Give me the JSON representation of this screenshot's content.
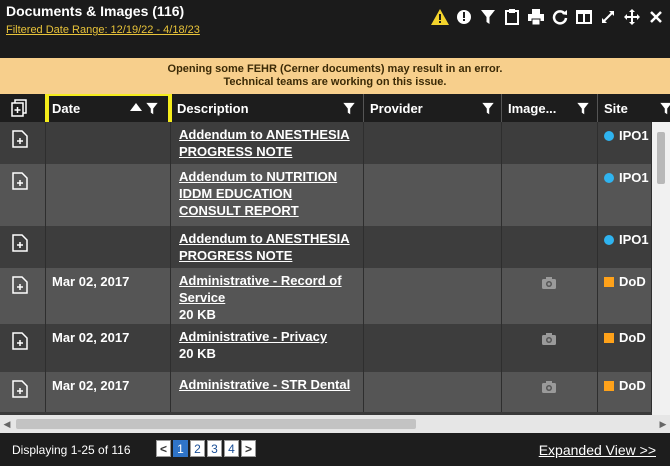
{
  "header": {
    "title": "Documents & Images (116)",
    "date_range": "Filtered Date Range: 12/19/22 - 4/18/23"
  },
  "toolbar": {
    "icons": [
      "warning-icon",
      "info-icon",
      "filter-icon",
      "clipboard-icon",
      "print-icon",
      "refresh-icon",
      "columns-icon",
      "expand-icon",
      "move-icon",
      "close-icon"
    ]
  },
  "banner": {
    "line1": "Opening some FEHR (Cerner documents) may result in an error.",
    "line2": "Technical teams are working on this issue."
  },
  "columns": {
    "date": "Date",
    "description": "Description",
    "provider": "Provider",
    "image": "Image...",
    "site": "Site"
  },
  "rows": [
    {
      "date": "",
      "desc_lines": [
        "Addendum to ANESTHESIA",
        "PROGRESS NOTE"
      ],
      "size": "",
      "image": "",
      "site": "IPO1",
      "site_type": "dot"
    },
    {
      "date": "",
      "desc_lines": [
        "Addendum to NUTRITION",
        "IDDM EDUCATION",
        "CONSULT REPORT"
      ],
      "size": "",
      "image": "",
      "site": "IPO1",
      "site_type": "dot"
    },
    {
      "date": "",
      "desc_lines": [
        "Addendum to ANESTHESIA",
        "PROGRESS NOTE"
      ],
      "size": "",
      "image": "",
      "site": "IPO1",
      "site_type": "dot"
    },
    {
      "date": "Mar 02, 2017",
      "desc_lines": [
        "Administrative - Record of",
        "Service"
      ],
      "size": "20 KB",
      "image": "camera",
      "site": "DoD",
      "site_type": "square"
    },
    {
      "date": "Mar 02, 2017",
      "desc_lines": [
        "Administrative - Privacy"
      ],
      "size": "20 KB",
      "image": "camera",
      "site": "DoD",
      "site_type": "square"
    },
    {
      "date": "Mar 02, 2017",
      "desc_lines": [
        "Administrative - STR Dental"
      ],
      "size": "",
      "image": "camera",
      "site": "DoD",
      "site_type": "square"
    }
  ],
  "colors": {
    "highlight": "#f5ec1b",
    "banner_bg": "#f7cf8c",
    "site_dot": "#2fb4f0",
    "site_square": "#ffa21a",
    "active_page": "#2f74c8"
  },
  "footer": {
    "display_text": "Displaying 1-25 of 116",
    "pages": [
      "1",
      "2",
      "3",
      "4"
    ],
    "active_page": "1",
    "prev": "<",
    "next": ">",
    "expanded_view": "Expanded View >>"
  }
}
